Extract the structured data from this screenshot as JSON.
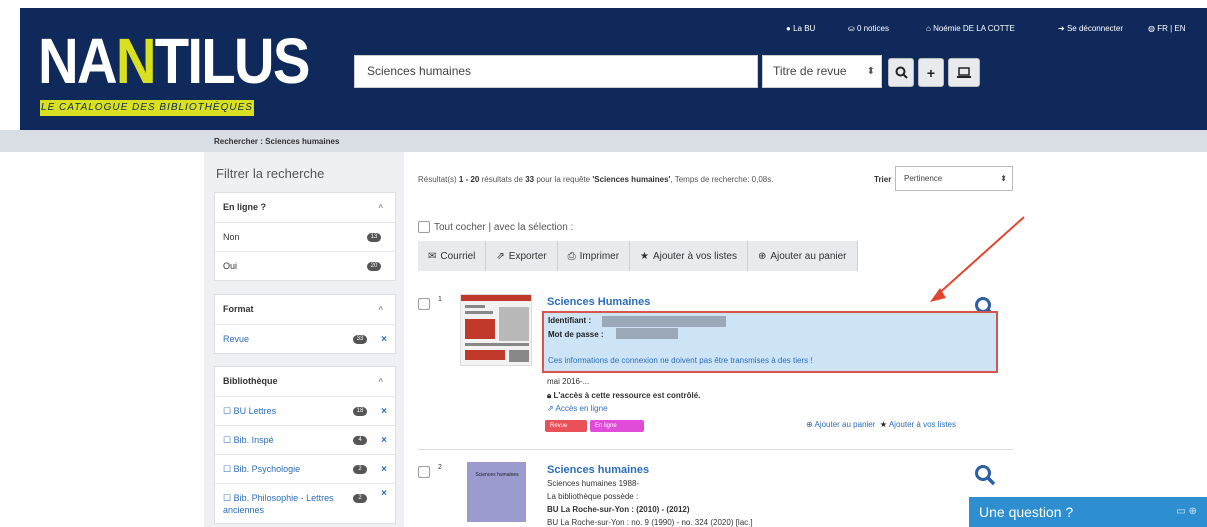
{
  "header": {
    "logo_prefix": "NA",
    "logo_accent": "N",
    "logo_suffix": "TILUS",
    "tagline": "LE CATALOGUE DES BIBLIOTHÈQUES",
    "search_value": "Sciences humaines",
    "search_type": "Titre de revue",
    "nav": {
      "la_bu": "La BU",
      "notices": "0 notices",
      "user": "Noémie DE LA COTTE",
      "logout": "Se déconnecter",
      "lang": "FR | EN"
    }
  },
  "breadcrumb": "Rechercher : Sciences humaines",
  "sidebar": {
    "title": "Filtrer la recherche",
    "online": {
      "heading": "En ligne ?",
      "items": [
        {
          "label": "Non",
          "count": "13"
        },
        {
          "label": "Oui",
          "count": "20"
        }
      ]
    },
    "format": {
      "heading": "Format",
      "items": [
        {
          "label": "Revue",
          "count": "33"
        }
      ]
    },
    "library": {
      "heading": "Bibliothèque",
      "items": [
        {
          "label": "☐ BU Lettres",
          "count": "18"
        },
        {
          "label": "☐ Bib. Inspé",
          "count": "4"
        },
        {
          "label": "☐ Bib. Psychologie",
          "count": "2"
        },
        {
          "label": "☐ Bib. Philosophie - Lettres anciennes",
          "count": "2"
        }
      ]
    }
  },
  "results": {
    "summary_prefix": "Résultat(s) ",
    "summary_range": "1 - 20",
    "summary_mid": " résultats de ",
    "summary_total": "33",
    "summary_query_lead": " pour la requête ",
    "summary_query": "'Sciences humaines'",
    "summary_time": ", Temps de recherche: 0,08s.",
    "sort_label": "Trier",
    "sort_value": "Pertinence",
    "check_all": "Tout cocher | avec la sélection :",
    "actions": {
      "email": "Courriel",
      "export": "Exporter",
      "print": "Imprimer",
      "lists": "Ajouter à vos listes",
      "cart": "Ajouter au panier"
    },
    "items": [
      {
        "num": "1",
        "title": "Sciences Humaines",
        "id_label": "Identifiant :",
        "pw_label": "Mot de passe :",
        "note": "Ces informations de connexion ne doivent pas être transmises à des tiers !",
        "date": "mai 2016-...",
        "access": "L'accès à cette ressource est contrôlé.",
        "access_link": "Accès en ligne",
        "tag1": "Revue",
        "tag2": "En ligne",
        "add_cart": "Ajouter au panier",
        "add_list": "Ajouter à vos listes"
      },
      {
        "num": "2",
        "title": "Sciences humaines",
        "thumb_text": "Sciences humaines",
        "line1": "Sciences humaines 1988-",
        "line2": "La bibliothèque possède :",
        "line3": "BU La Roche-sur-Yon : (2010) - (2012)",
        "line4": "BU La Roche-sur-Yon : no. 9 (1990) - no. 324 (2020) [lac.]"
      }
    ]
  },
  "chat": {
    "label": "Une question ?"
  }
}
